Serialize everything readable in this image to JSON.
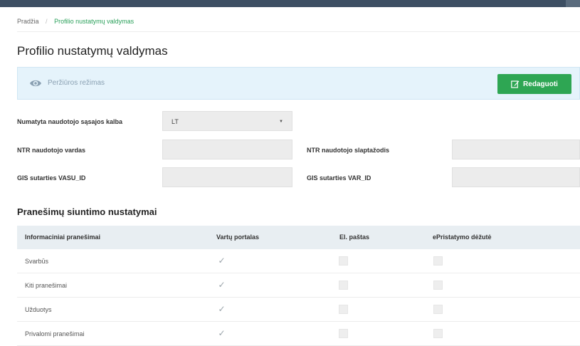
{
  "breadcrumb": {
    "home": "Pradžia",
    "separator": "/",
    "current": "Profilio nustatymų valdymas"
  },
  "page": {
    "title": "Profilio nustatymų valdymas"
  },
  "mode_panel": {
    "icon": "eye-icon",
    "label": "Peržiūros režimas",
    "edit_button": "Redaguoti",
    "edit_icon": "edit-icon"
  },
  "fields": {
    "language_label": "Numatyta naudotojo sąsajos kalba",
    "language_value": "LT",
    "ntr_username_label": "NTR naudotojo vardas",
    "ntr_username_value": "",
    "ntr_password_label": "NTR naudotojo slaptažodis",
    "ntr_password_value": "",
    "gis_vasu_label": "GIS sutarties VASU_ID",
    "gis_vasu_value": "",
    "gis_var_label": "GIS sutarties VAR_ID",
    "gis_var_value": ""
  },
  "notifications": {
    "title": "Pranešimų siuntimo nustatymai",
    "headers": [
      "Informaciniai pranešimai",
      "Vartų portalas",
      "El. paštas",
      "ePristatymo dėžutė"
    ],
    "rows": [
      {
        "label": "Svarbūs",
        "portal": true,
        "email": false,
        "ebox": false
      },
      {
        "label": "Kiti pranešimai",
        "portal": true,
        "email": false,
        "ebox": false
      },
      {
        "label": "Užduotys",
        "portal": true,
        "email": false,
        "ebox": false
      },
      {
        "label": "Privalomi pranešimai",
        "portal": true,
        "email": false,
        "ebox": false
      }
    ]
  },
  "colors": {
    "accent": "#2ea653",
    "topbar": "#3d4f63",
    "info_panel": "#e5f3fb"
  }
}
